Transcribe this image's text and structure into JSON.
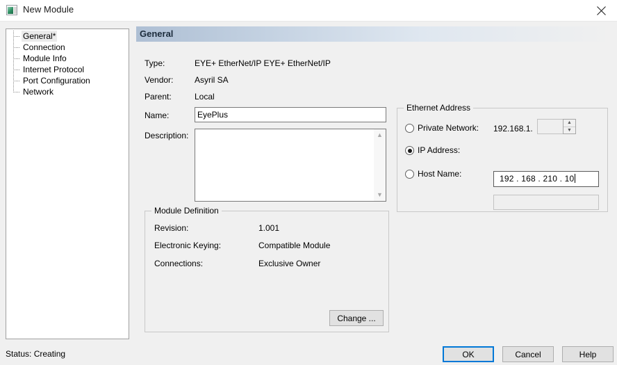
{
  "window": {
    "title": "New Module",
    "icon": "module-icon",
    "close_icon": "close-icon"
  },
  "sidebar": {
    "items": [
      {
        "label": "General*",
        "selected": true
      },
      {
        "label": "Connection",
        "selected": false
      },
      {
        "label": "Module Info",
        "selected": false
      },
      {
        "label": "Internet Protocol",
        "selected": false
      },
      {
        "label": "Port Configuration",
        "selected": false
      },
      {
        "label": "Network",
        "selected": false
      }
    ]
  },
  "main": {
    "section_title": "General",
    "fields": {
      "type_label": "Type:",
      "type_value": "EYE+ EtherNet/IP EYE+ EtherNet/IP",
      "vendor_label": "Vendor:",
      "vendor_value": "Asyril SA",
      "parent_label": "Parent:",
      "parent_value": "Local",
      "name_label": "Name:",
      "name_value": "EyePlus",
      "description_label": "Description:",
      "description_value": "",
      "scroll_up_icon": "chevron-up-icon",
      "scroll_down_icon": "chevron-down-icon"
    },
    "ethernet": {
      "group_title": "Ethernet Address",
      "private_network_label": "Private Network:",
      "private_network_selected": false,
      "private_network_prefix": "192.168.1.",
      "private_network_value": "",
      "spinner_up_icon": "spinner-up-icon",
      "spinner_down_icon": "spinner-down-icon",
      "ip_address_label": "IP Address:",
      "ip_address_selected": true,
      "ip_address_value": "192 . 168 . 210 .  10",
      "host_name_label": "Host Name:",
      "host_name_selected": false,
      "host_name_value": ""
    },
    "module_definition": {
      "group_title": "Module Definition",
      "revision_label": "Revision:",
      "revision_value": "1.001",
      "electronic_keying_label": "Electronic Keying:",
      "electronic_keying_value": "Compatible Module",
      "connections_label": "Connections:",
      "connections_value": "Exclusive Owner",
      "change_button_label": "Change ..."
    }
  },
  "footer": {
    "status": "Status: Creating",
    "ok_label": "OK",
    "cancel_label": "Cancel",
    "help_label": "Help"
  },
  "colors": {
    "focus_blue": "#0078d7",
    "dialog_bg": "#f0f0f0",
    "header_gradient_start": "#aebfd4"
  }
}
